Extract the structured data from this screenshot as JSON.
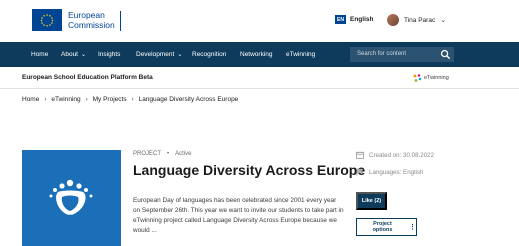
{
  "header": {
    "brand_line1": "European",
    "brand_line2": "Commission",
    "lang_code": "EN",
    "lang_label": "English",
    "user_name": "Tina Parac"
  },
  "nav": {
    "items": [
      "Home",
      "About",
      "Insights",
      "Development",
      "Recognition",
      "Networking",
      "eTwinning"
    ],
    "search_placeholder": "Search for content"
  },
  "platform": {
    "title": "European School Education Platform Beta",
    "partner_label": "eTwinning"
  },
  "breadcrumb": [
    "Home",
    "eTwinning",
    "My Projects",
    "Language Diversity Across Europe"
  ],
  "project": {
    "kind": "PROJECT",
    "status": "Active",
    "title": "Language Diversity Across Europe",
    "description": "European Day of languages has been celebrated since 2001 every year on September 26th. This year we want to invite our students to take part in eTwinning project called Language Diversity Across Europe because we would ...",
    "created": "Created on: 30.08.2022",
    "languages": "Languages: English",
    "like_label": "Like (2)",
    "options_label": "Project options"
  },
  "colors": {
    "nav_bg": "#0e3b5c",
    "ec_blue": "#004494",
    "project_image_bg": "#1a6fb8"
  }
}
